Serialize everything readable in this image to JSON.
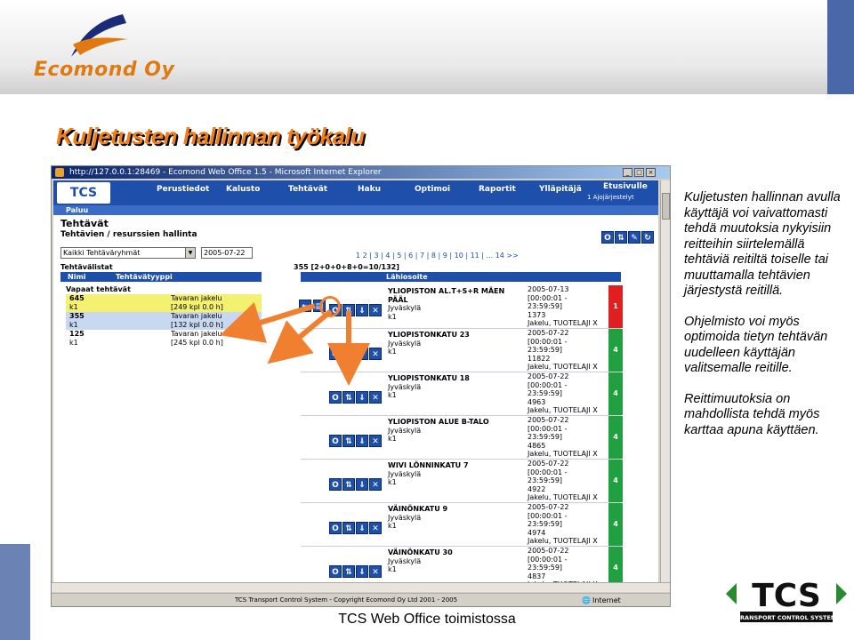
{
  "company": {
    "name": "Ecomond Oy"
  },
  "slide": {
    "heading": "Kuljetusten hallinnan työkalu",
    "caption": "TCS Web Office toimistossa",
    "description": [
      "Kuljetusten hallinnan avulla käyttäjä voi vaivattomasti tehdä muutoksia nykyisiin reitteihin siirtelemällä tehtäviä reitiltä toiselle tai muuttamalla tehtävien järjestystä reitillä.",
      "Ohjelmisto voi myös optimoida tietyn tehtävän uudelleen käyttäjän valitsemalle reitille.",
      "Reittimuutoksia on mahdollista tehdä myös karttaa apuna käyttäen."
    ],
    "logo": {
      "letters": "TCS",
      "tagline": "TRANSPORT CONTROL SYSTEM"
    }
  },
  "browser": {
    "title": "http://127.0.0.1:28469 - Ecomond Web Office 1.5 - Microsoft Internet Explorer",
    "status": "Internet",
    "footer": "TCS Transport Control System - Copyright Ecomond Oy Ltd 2001 - 2005"
  },
  "app": {
    "logo": "TCS",
    "nav": [
      "Perustiedot",
      "Kalusto",
      "Tehtävät",
      "Haku",
      "Optimoi",
      "Raportit",
      "Ylläpitäjä"
    ],
    "etusivu": "Etusivulle",
    "ajojarjestys": "1 Ajojärjestelyt",
    "paluu": "Paluu",
    "page_title": "Tehtävät",
    "subtitle": "Tehtävien / resurssien hallinta",
    "group_select": "Kaikki Tehtäväryhmät",
    "date": "2005-07-22",
    "pager": "1 2 | 3 | 4 | 5 | 6 | 7 | 8 | 9 | 10 | 11 | ... 14 >>",
    "tasklist_label": "Tehtävälistat",
    "tasklist_count": "355 [2+0+0+8+0=10/132]",
    "left_headers": {
      "name": "Nimi",
      "type": "Tehtävätyyppi"
    },
    "right_header": "Lähiosoite",
    "free_tasks": "Vapaat tehtävät",
    "left_rows": [
      {
        "n1": "645",
        "n2": "k1",
        "t1": "Tavaran jakelu",
        "t2": "[249 kpl 0.0 h]",
        "color": "#f4f070"
      },
      {
        "n1": "355",
        "n2": "k1",
        "t1": "Tavaran jakelu",
        "t2": "[132 kpl 0.0 h]",
        "color": "#c8d8f0"
      },
      {
        "n1": "125",
        "n2": "k1",
        "t1": "Tavaran jakelu",
        "t2": "[245 kpl 0.0 h]",
        "color": "#ffffff"
      }
    ],
    "right_rows": [
      {
        "a1": "YLIOPISTON AL.T+S+R MÄEN",
        "a2": "PÄÄL",
        "a3": "Jyväskylä",
        "a4": "k1",
        "d": "2005-07-13",
        "w1": "[00:00:01 -",
        "w2": "23:59:59]",
        "id": "1373",
        "j": "Jakelu, TUOTELAJI X",
        "c": "1",
        "col": "#e02020"
      },
      {
        "a1": "YLIOPISTONKATU 23",
        "a2": "Jyväskylä",
        "a3": "k1",
        "a4": "",
        "d": "2005-07-22",
        "w1": "[00:00:01 -",
        "w2": "23:59:59]",
        "id": "11822",
        "j": "Jakelu, TUOTELAJI X",
        "c": "4",
        "col": "#20a040"
      },
      {
        "a1": "YLIOPISTONKATU 18",
        "a2": "Jyväskylä",
        "a3": "k1",
        "a4": "",
        "d": "2005-07-22",
        "w1": "[00:00:01 -",
        "w2": "23:59:59]",
        "id": "4963",
        "j": "Jakelu, TUOTELAJI X",
        "c": "4",
        "col": "#20a040"
      },
      {
        "a1": "YLIOPISTON ALUE B-TALO",
        "a2": "Jyväskylä",
        "a3": "k1",
        "a4": "",
        "d": "2005-07-22",
        "w1": "[00:00:01 -",
        "w2": "23:59:59]",
        "id": "4865",
        "j": "Jakelu, TUOTELAJI X",
        "c": "4",
        "col": "#20a040"
      },
      {
        "a1": "WIVI LÖNNINKATU 7",
        "a2": "Jyväskylä",
        "a3": "k1",
        "a4": "",
        "d": "2005-07-22",
        "w1": "[00:00:01 -",
        "w2": "23:59:59]",
        "id": "4922",
        "j": "Jakelu, TUOTELAJI X",
        "c": "4",
        "col": "#20a040"
      },
      {
        "a1": "VÄINÖNKATU 9",
        "a2": "Jyväskylä",
        "a3": "k1",
        "a4": "",
        "d": "2005-07-22",
        "w1": "[00:00:01 -",
        "w2": "23:59:59]",
        "id": "4974",
        "j": "Jakelu, TUOTELAJI X",
        "c": "4",
        "col": "#20a040"
      },
      {
        "a1": "VÄINÖNKATU 30",
        "a2": "Jyväskylä",
        "a3": "k1",
        "a4": "",
        "d": "2005-07-22",
        "w1": "[00:00:01 -",
        "w2": "23:59:59]",
        "id": "4837",
        "j": "Jakelu, TUOTELAJI X",
        "c": "4",
        "col": "#20a040"
      }
    ]
  }
}
